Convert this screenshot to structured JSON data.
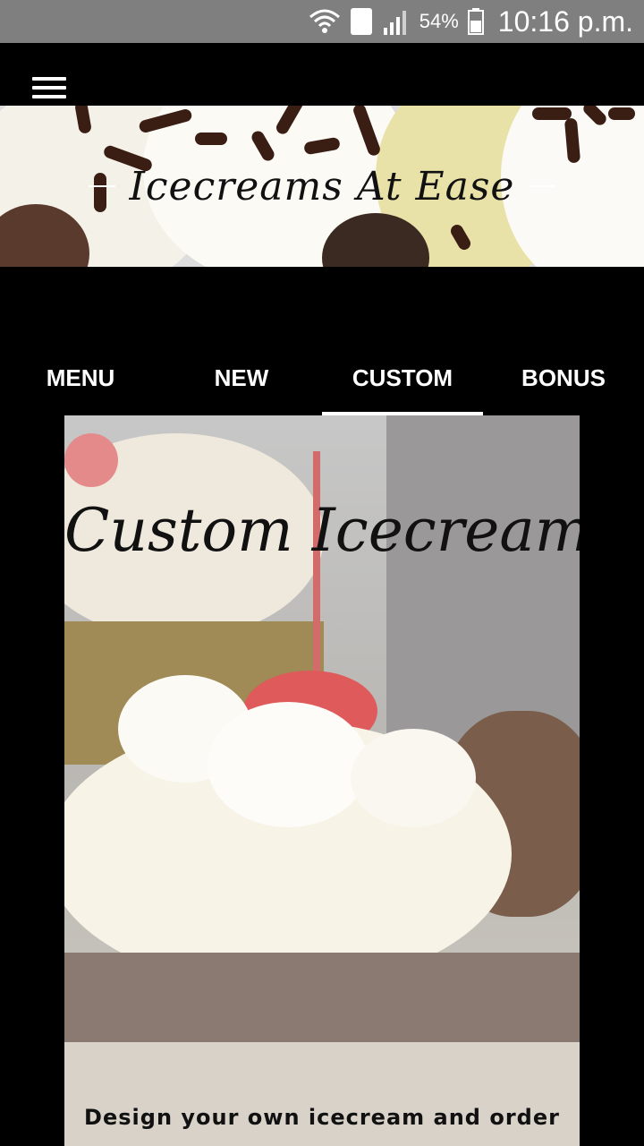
{
  "status_bar": {
    "battery": "54%",
    "time": "10:16 p.m.",
    "sim_badge": "1",
    "icons": [
      "wifi-icon",
      "sim-icon",
      "signal-icon",
      "battery-icon"
    ]
  },
  "app_bar": {
    "menu_icon": "hamburger-menu-icon"
  },
  "hero": {
    "title": "Icecreams At Ease"
  },
  "tabs": [
    {
      "label": "MENU",
      "active": false
    },
    {
      "label": "NEW",
      "active": false
    },
    {
      "label": "CUSTOM",
      "active": true
    },
    {
      "label": "BONUS",
      "active": false
    }
  ],
  "card": {
    "title": "Custom Icecream",
    "caption": "Design your own icecream and order"
  },
  "colors": {
    "background": "#000000",
    "status_bar": "#7f7f7f",
    "tab_text": "#ffffff",
    "tab_indicator": "#ffffff"
  }
}
